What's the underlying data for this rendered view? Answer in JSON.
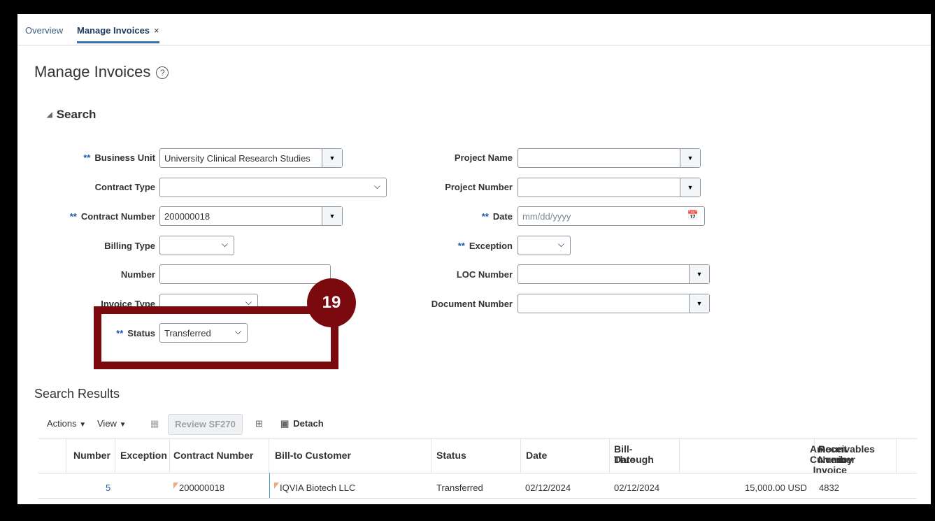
{
  "tabs": {
    "overview": "Overview",
    "manage": "Manage Invoices",
    "close": "×"
  },
  "page": {
    "title": "Manage Invoices",
    "help": "?"
  },
  "search": {
    "header": "Search",
    "required_marker": "**",
    "business_unit": {
      "label": "Business Unit",
      "value": "University Clinical Research Studies"
    },
    "contract_type": {
      "label": "Contract Type",
      "value": ""
    },
    "contract_number": {
      "label": "Contract Number",
      "value": "200000018"
    },
    "billing_type": {
      "label": "Billing Type",
      "value": ""
    },
    "number": {
      "label": "Number",
      "value": ""
    },
    "invoice_type": {
      "label": "Invoice Type",
      "value": ""
    },
    "status": {
      "label": "Status",
      "value": "Transferred"
    },
    "project_name": {
      "label": "Project Name",
      "value": ""
    },
    "project_number": {
      "label": "Project Number",
      "value": ""
    },
    "date": {
      "label": "Date",
      "placeholder": "mm/dd/yyyy"
    },
    "exception": {
      "label": "Exception",
      "value": ""
    },
    "loc_number": {
      "label": "LOC Number",
      "value": ""
    },
    "document_number": {
      "label": "Document Number",
      "value": ""
    }
  },
  "callout": {
    "number": "19"
  },
  "results": {
    "title": "Search Results",
    "toolbar": {
      "actions": "Actions",
      "view": "View",
      "review": "Review SF270",
      "detach": "Detach"
    },
    "columns": {
      "number": "Number",
      "exception": "Exception",
      "contract_number": "Contract Number",
      "bill_to": "Bill-to Customer",
      "status": "Status",
      "date": "Date",
      "bill_through_1": "Bill-Through",
      "bill_through_2": "Date",
      "amount_1": "Amount in Invoice",
      "amount_2": "Currency",
      "receivables_1": "Receivables",
      "receivables_2": "Number"
    },
    "row": {
      "number": "5",
      "exception": "",
      "contract_number": "200000018",
      "bill_to": "IQVIA Biotech LLC",
      "status": "Transferred",
      "date": "02/12/2024",
      "bill_through": "02/12/2024",
      "amount": "15,000.00 USD",
      "receivables": "4832"
    }
  }
}
